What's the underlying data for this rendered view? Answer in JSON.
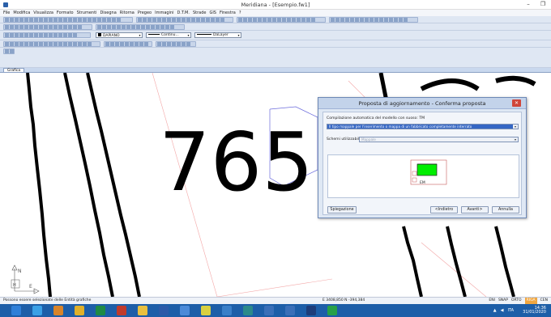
{
  "window": {
    "title": "Meridiana - [Esempio.fw1]",
    "minimize": "–",
    "maximize": "❐"
  },
  "menu": [
    "File",
    "Modifica",
    "Visualizza",
    "Formato",
    "Strumenti",
    "Disegna",
    "Ritorna",
    "Pregeo",
    "Immagini",
    "D.T.M.",
    "Strade",
    "GIS",
    "Finestra",
    "?"
  ],
  "toolbar": {
    "layer_combo": "DAPIANO",
    "linetype_combo": "Continu...",
    "lineweight_combo": "DaLayer"
  },
  "tabs": [
    "Grafica"
  ],
  "canvas": {
    "number_text": "765",
    "axis_labels": {
      "n": "N",
      "h": "H",
      "e": "E"
    }
  },
  "dialog": {
    "title": "Proposta di aggiornamento - Conferma proposta",
    "close": "✕",
    "model_label": "Compilazione automatica del modello con suoso: TM",
    "model_select": "Il tipo mappale per l'inserimento o mappa di un fabbricato completamente interrato",
    "schemes_label": "Schemi utilizzabili:",
    "schemes_select": "Mappale",
    "preview_label": "EM",
    "buttons": {
      "explanation": "Spiegazione",
      "back": "<Indietro",
      "next": "Avanti>",
      "cancel": "Annulla"
    }
  },
  "status": {
    "message": "Possono essere selezionate delle Entità grafiche",
    "coords": "E 3408,850  N  -394,384",
    "flags": [
      "ENI",
      "SNAP",
      "ORTO",
      "RIGA",
      "CEN"
    ],
    "active_flag": "RIGA"
  },
  "taskbar": {
    "lang": "ITA",
    "time": "14:36",
    "date": "31/01/2020"
  },
  "colors": {
    "dialog_select_bg": "#3466c4",
    "taskbar": "#1d5ea8",
    "green_box": "#00ee00"
  }
}
